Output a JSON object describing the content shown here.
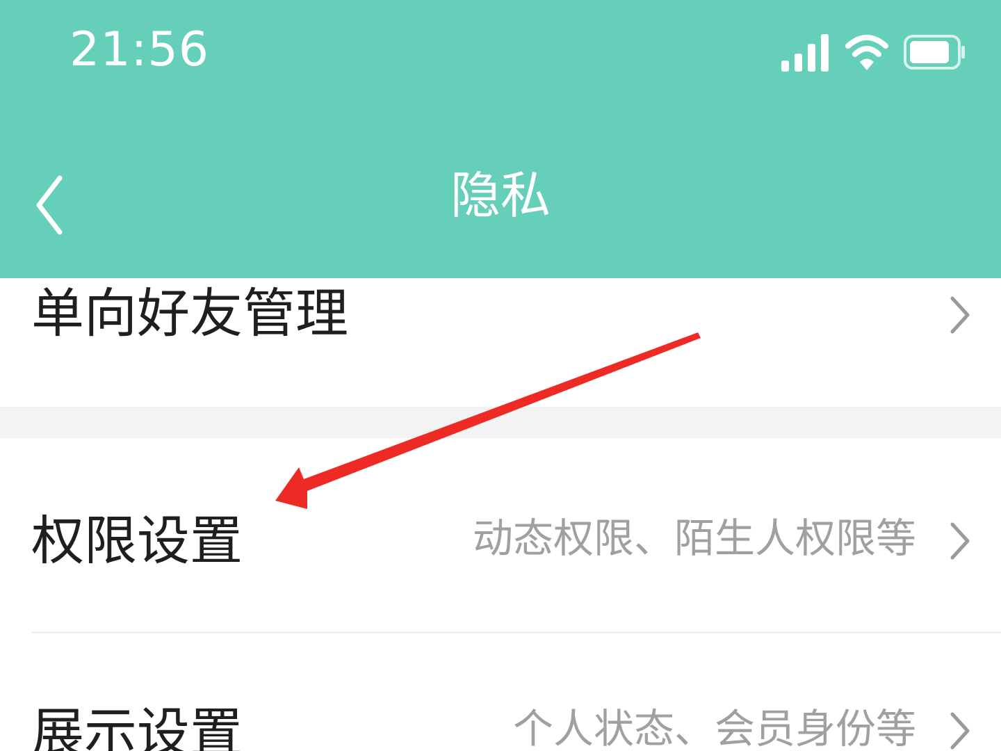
{
  "status_bar": {
    "time": "21:56",
    "icons": [
      "signal-icon",
      "wifi-icon",
      "battery-icon"
    ]
  },
  "nav": {
    "title": "隐私",
    "back_icon": "chevron-left-icon"
  },
  "rows": [
    {
      "label": "单向好友管理",
      "hint": ""
    },
    {
      "label": "权限设置",
      "hint": "动态权限、陌生人权限等"
    },
    {
      "label": "展示设置",
      "hint": "个人状态、会员身份等"
    }
  ],
  "colors": {
    "header_bg": "#66cfb9",
    "annotation_arrow": "#ee2a24"
  }
}
